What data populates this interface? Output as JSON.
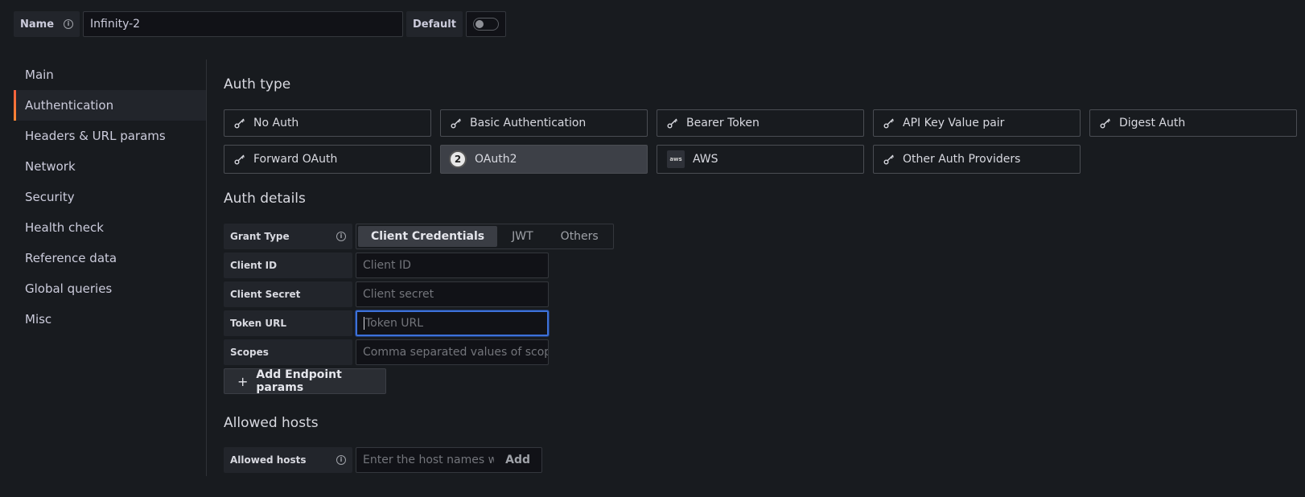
{
  "topbar": {
    "name_label": "Name",
    "name_value": "Infinity-2",
    "default_label": "Default",
    "default_toggle_on": false
  },
  "sidebar": {
    "items": [
      {
        "label": "Main"
      },
      {
        "label": "Authentication",
        "active": true
      },
      {
        "label": "Headers & URL params"
      },
      {
        "label": "Network"
      },
      {
        "label": "Security"
      },
      {
        "label": "Health check"
      },
      {
        "label": "Reference data"
      },
      {
        "label": "Global queries"
      },
      {
        "label": "Misc"
      }
    ]
  },
  "auth_type": {
    "title": "Auth type",
    "options": [
      {
        "label": "No Auth",
        "icon": "key-icon"
      },
      {
        "label": "Basic Authentication",
        "icon": "key-icon"
      },
      {
        "label": "Bearer Token",
        "icon": "key-icon"
      },
      {
        "label": "API Key Value pair",
        "icon": "key-icon"
      },
      {
        "label": "Digest Auth",
        "icon": "key-icon"
      },
      {
        "label": "Forward OAuth",
        "icon": "key-icon"
      },
      {
        "label": "OAuth2",
        "icon": "oauth2-icon",
        "selected": true
      },
      {
        "label": "AWS",
        "icon": "aws-icon",
        "icon_text": "aws"
      },
      {
        "label": "Other Auth Providers",
        "icon": "key-icon"
      }
    ]
  },
  "auth_details": {
    "title": "Auth details",
    "grant_type": {
      "label": "Grant Type",
      "options": [
        "Client Credentials",
        "JWT",
        "Others"
      ],
      "selected": "Client Credentials"
    },
    "client_id": {
      "label": "Client ID",
      "placeholder": "Client ID"
    },
    "client_secret": {
      "label": "Client Secret",
      "placeholder": "Client secret"
    },
    "token_url": {
      "label": "Token URL",
      "placeholder": "Token URL"
    },
    "scopes": {
      "label": "Scopes",
      "placeholder": "Comma separated values of scop"
    },
    "add_endpoint_label": "Add Endpoint params"
  },
  "allowed_hosts": {
    "title": "Allowed hosts",
    "label": "Allowed hosts",
    "placeholder": "Enter the host names wit",
    "add_label": "Add"
  },
  "colors": {
    "background": "#181b1f",
    "accent_focus": "#3d71d9",
    "active_indicator": "#f55f3e"
  }
}
